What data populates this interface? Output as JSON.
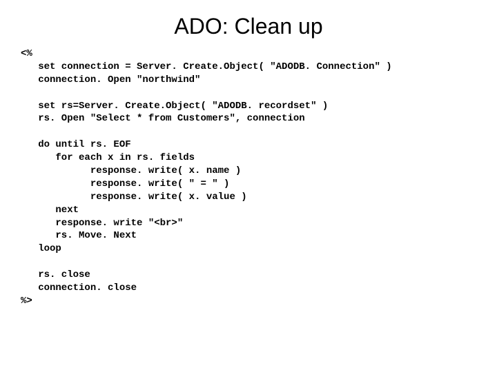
{
  "title": "ADO: Clean up",
  "code": "<%\n   set connection = Server. Create.Object( \"ADODB. Connection\" )\n   connection. Open \"northwind\"\n\n   set rs=Server. Create.Object( \"ADODB. recordset\" )\n   rs. Open \"Select * from Customers\", connection\n\n   do until rs. EOF\n      for each x in rs. fields\n            response. write( x. name )\n            response. write( \" = \" )\n            response. write( x. value )\n      next\n      response. write \"<br>\"\n      rs. Move. Next\n   loop\n\n   rs. close\n   connection. close\n%>"
}
